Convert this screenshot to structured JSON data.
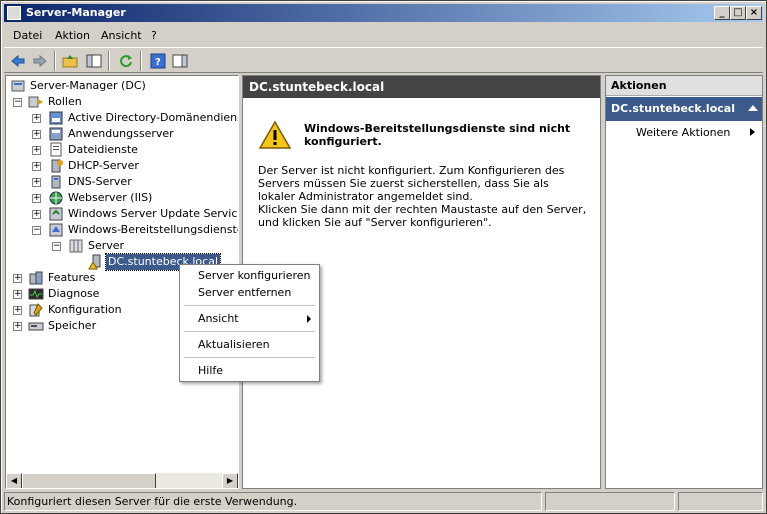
{
  "window": {
    "title": "Server-Manager"
  },
  "menu": [
    "Datei",
    "Aktion",
    "Ansicht",
    "?"
  ],
  "tree": {
    "root": "Server-Manager (DC)",
    "roles": "Rollen",
    "role_items": [
      "Active Directory-Domänendienste",
      "Anwendungsserver",
      "Dateidienste",
      "DHCP-Server",
      "DNS-Server",
      "Webserver (IIS)",
      "Windows Server Update Services (W",
      "Windows-Bereitstellungsdienste"
    ],
    "server": "Server",
    "dc": "DC.stuntebeck.local",
    "others": [
      "Features",
      "Diagnose",
      "Konfiguration",
      "Speicher"
    ]
  },
  "center": {
    "header": "DC.stuntebeck.local",
    "warn_title": "Windows-Bereitstellungsdienste sind nicht konfiguriert.",
    "body1": "Der Server ist nicht konfiguriert. Zum Konfigurieren des Servers müssen Sie zuerst sicherstellen, dass Sie als lokaler Administrator angemeldet sind.",
    "body2": "Klicken Sie dann mit der rechten Maustaste auf den Server, und klicken Sie auf \"Server konfigurieren\"."
  },
  "actions": {
    "header": "Aktionen",
    "sub": "DC.stuntebeck.local",
    "more": "Weitere Aktionen"
  },
  "context_menu": {
    "items": [
      "Server konfigurieren",
      "Server entfernen",
      "Ansicht",
      "Aktualisieren",
      "Hilfe"
    ]
  },
  "status": {
    "text": "Konfiguriert diesen Server für die erste Verwendung."
  }
}
